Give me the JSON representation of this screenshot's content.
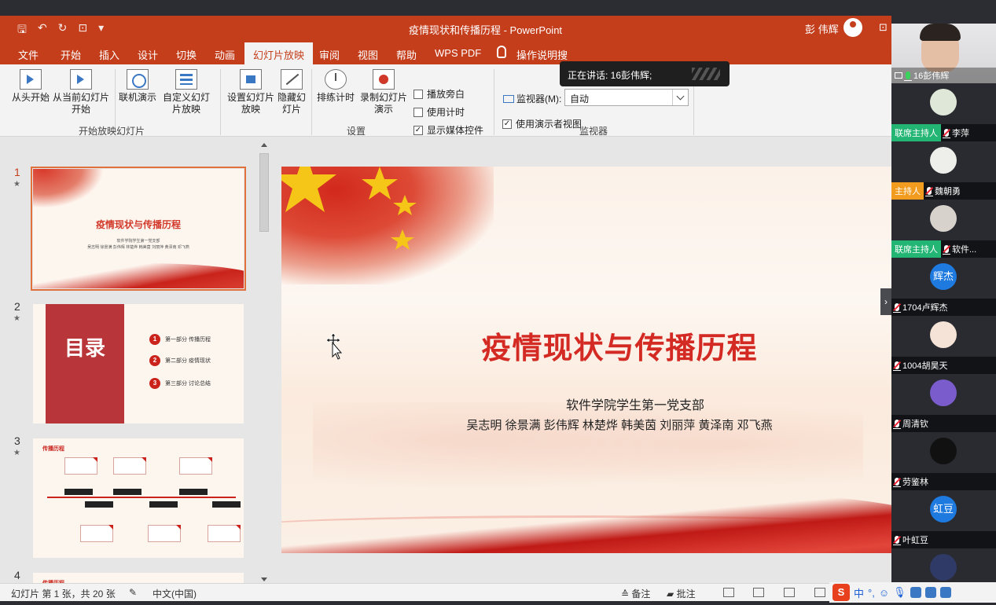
{
  "window": {
    "title": "疫情现状和传播历程 - PowerPoint",
    "user": "彭 伟辉"
  },
  "qat": [
    "🖫",
    "↶",
    "↻",
    "⊡",
    "▾"
  ],
  "tabs": [
    "文件",
    "开始",
    "插入",
    "设计",
    "切换",
    "动画",
    "幻灯片放映",
    "审阅",
    "视图",
    "帮助",
    "WPS PDF",
    "操作说明搜"
  ],
  "active_tab": "幻灯片放映",
  "ribbon": {
    "from_start": "从头开始",
    "from_current": "从当前幻灯片开始",
    "online": "联机演示",
    "custom": "自定义幻灯片放映",
    "group1": "开始放映幻灯片",
    "setup": "设置幻灯片放映",
    "hide": "隐藏幻灯片",
    "rehearse": "排练计时",
    "record": "录制幻灯片演示",
    "play_narration": "播放旁白",
    "use_timings": "使用计时",
    "show_media": "显示媒体控件",
    "group2": "设置",
    "monitor_label": "监视器(M):",
    "monitor_value": "自动",
    "presenter_view": "使用演示者视图",
    "group3": "监视器"
  },
  "speaking": "正在讲话: 16彭伟辉;",
  "thumbnails": {
    "s1_title": "疫情现状与传播历程",
    "s1_sub": "软件学院学生第一党支部",
    "s1_names": "吴志明 徐景满 彭伟辉 林楚烨 韩美茵 刘丽萍 黄泽南 邓飞燕",
    "s2_title": "目录",
    "s2_items": [
      "第一部分 传播历程",
      "第二部分 疫情现状",
      "第三部分 讨论总结"
    ],
    "s3_header": "传播历程",
    "s4_header": "传播历程"
  },
  "main_slide": {
    "title": "疫情现状与传播历程",
    "subtitle": "软件学院学生第一党支部",
    "names": "吴志明 徐景满 彭伟辉 林楚烨 韩美茵 刘丽萍 黄泽南 邓飞燕"
  },
  "status": {
    "slide_info": "幻灯片 第 1 张，共 20 张",
    "language": "中文(中国)",
    "notes": "≙ 备注",
    "comments": "批注"
  },
  "participants": [
    {
      "name": "16彭伟辉",
      "role": ""
    },
    {
      "name": "李萍",
      "role": "联席主持人"
    },
    {
      "name": "魏朝勇",
      "role": "主持人"
    },
    {
      "name": "软件...",
      "role": "联席主持人"
    },
    {
      "name": "1704卢辉杰",
      "role": "",
      "avatar_text": "辉杰"
    },
    {
      "name": "1004胡昊天",
      "role": ""
    },
    {
      "name": "周清钦",
      "role": ""
    },
    {
      "name": "劳鉴林",
      "role": ""
    },
    {
      "name": "叶虹豆",
      "role": "",
      "avatar_text": "虹豆"
    }
  ],
  "tray": {
    "ime": "中",
    "punct": "°,"
  },
  "colors": {
    "ppt_accent": "#c43e1c",
    "cohost": "#22b573",
    "host": "#f29c1f",
    "slide_red": "#d42a24"
  }
}
